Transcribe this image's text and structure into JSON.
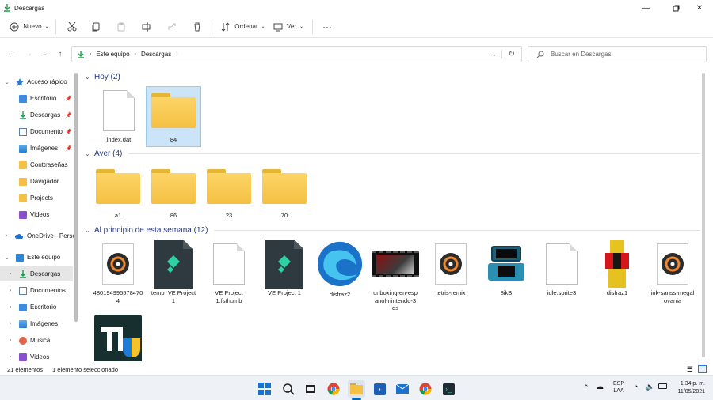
{
  "window": {
    "title": "Descargas"
  },
  "toolbar": {
    "new_label": "Nuevo",
    "sort_label": "Ordenar",
    "view_label": "Ver",
    "more_label": "···"
  },
  "address": {
    "crumbs": [
      "Este equipo",
      "Descargas"
    ]
  },
  "search": {
    "placeholder": "Buscar en Descargas"
  },
  "sidebar": {
    "quick_access": "Acceso rápido",
    "quick_items": [
      "Escritorio",
      "Descargas",
      "Documento",
      "Imágenes",
      "Conttraseñas",
      "Davigador",
      "Projects",
      "Videos"
    ],
    "onedrive": "OneDrive - Perso",
    "this_pc": "Este equipo",
    "pc_items": [
      "Descargas",
      "Documentos",
      "Escritorio",
      "Imágenes",
      "Música",
      "Videos"
    ]
  },
  "groups": {
    "today": {
      "title": "Hoy (2)",
      "files": [
        "index.dat",
        "84"
      ]
    },
    "yesterday": {
      "title": "Ayer (4)",
      "files": [
        "a1",
        "86",
        "23",
        "70"
      ]
    },
    "week": {
      "title": "Al principio de esta semana (12)",
      "files": [
        "480194995578470\n4",
        "temp_VE Project\n1",
        "VE Project\n1.fsthumb",
        "VE Project 1",
        "disfraz2",
        "unboxing-en-esp\nanol-nintendo-3\nds",
        "tetris-remix",
        "8ikB",
        "idle.sprite3",
        "disfraz1",
        "ink-sanss-megal\novania"
      ]
    }
  },
  "status": {
    "count": "21 elementos",
    "selected": "1 elemento seleccionado"
  },
  "tray": {
    "lang1": "ESP",
    "lang2": "LAA",
    "time": "1:34 p. m.",
    "date": "11/05/2021"
  },
  "colors": {
    "accent": "#0067c0",
    "folder": "#f5c043",
    "selected": "#cce4f7"
  }
}
